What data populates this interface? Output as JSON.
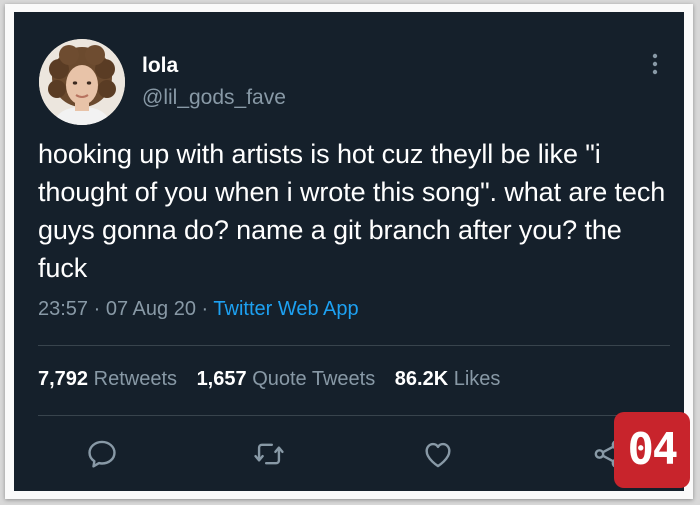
{
  "tweet": {
    "display_name": "lola",
    "handle": "@lil_gods_fave",
    "text": "hooking up with artists is hot cuz theyll be like \"i thought of you when i wrote this song\". what are tech guys gonna do? name a git branch after you? the fuck",
    "time": "23:57",
    "separator": "·",
    "date": "07 Aug 20",
    "source": "Twitter Web App"
  },
  "stats": {
    "retweets_count": "7,792",
    "retweets_label": "Retweets",
    "quotes_count": "1,657",
    "quotes_label": "Quote Tweets",
    "likes_count": "86.2K",
    "likes_label": "Likes"
  },
  "actions": [
    "reply-icon",
    "retweet-icon",
    "like-icon",
    "share-icon"
  ],
  "badge": {
    "text": "04"
  },
  "colors": {
    "background": "#15202b",
    "text": "#ffffff",
    "secondary": "#8899a6",
    "link": "#1da1f2",
    "badge": "#c8242c"
  }
}
